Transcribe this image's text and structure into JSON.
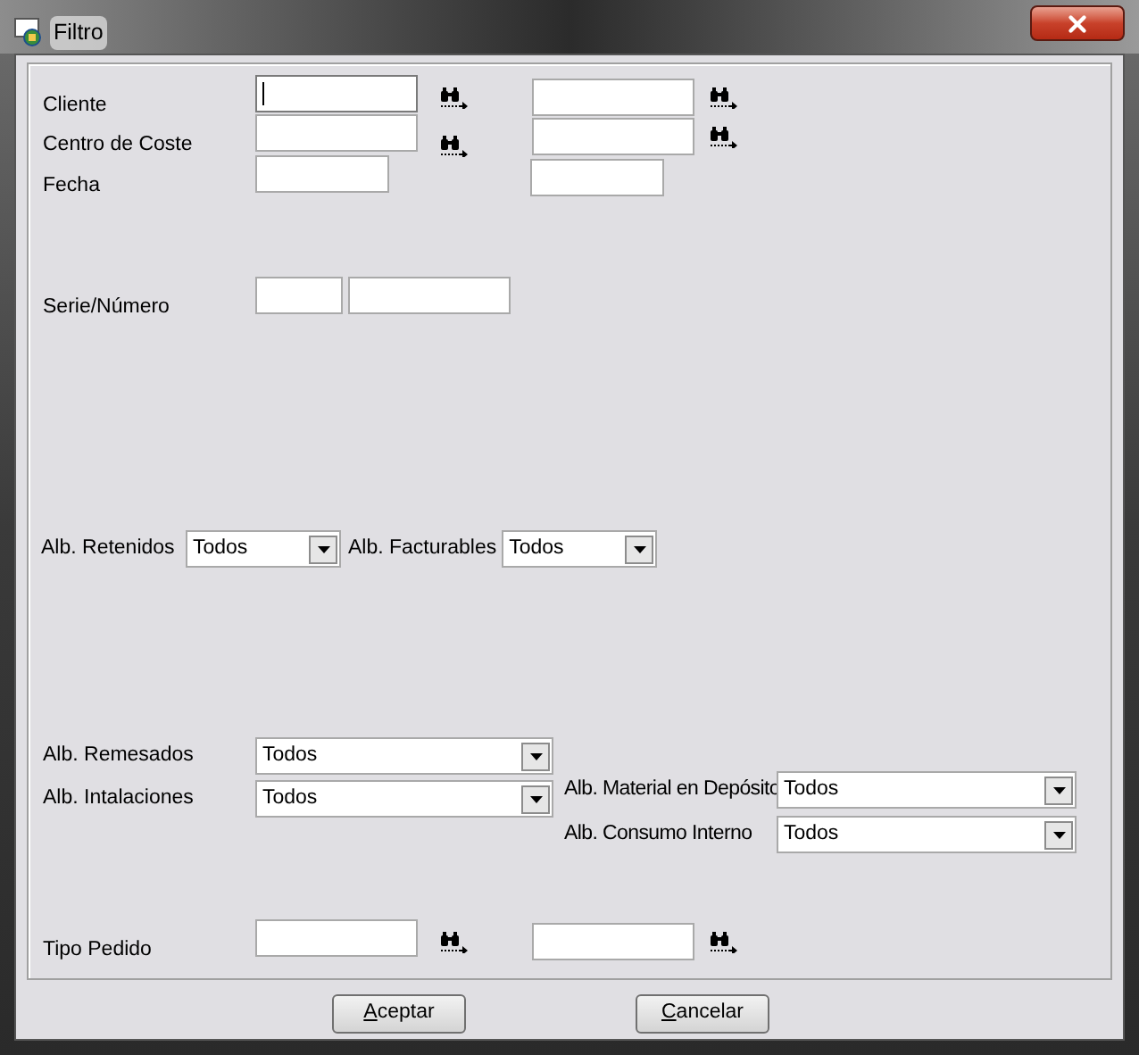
{
  "window": {
    "title": "Filtro"
  },
  "top_rows": [
    {
      "label": "Cliente",
      "fields": [
        {
          "kind": "lookup",
          "focused": true
        },
        {
          "kind": "lookup",
          "focused": false
        }
      ]
    },
    {
      "label": "Centro de Coste",
      "fields": [
        {
          "kind": "lookup",
          "focused": false
        },
        {
          "kind": "lookup",
          "focused": false
        }
      ]
    },
    {
      "label": "Fecha",
      "fields": [
        {
          "kind": "date",
          "focused": false
        },
        {
          "kind": "date",
          "focused": false
        }
      ]
    },
    {
      "label": "Serie/Número",
      "fields": [
        {
          "kind": "short",
          "focused": false
        },
        {
          "kind": "text",
          "focused": false
        }
      ]
    }
  ],
  "combos_row": [
    {
      "label": "Alb. Retenidos",
      "value": "Todos"
    },
    {
      "label": "Alb. Facturables",
      "value": "Todos"
    }
  ],
  "combos_left": [
    {
      "label": "Alb. Remesados",
      "value": "Todos"
    },
    {
      "label": "Alb. Intalaciones",
      "value": "Todos"
    }
  ],
  "combos_right": [
    {
      "label": "Alb. Material en Depósito",
      "value": "Todos"
    },
    {
      "label": "Alb. Consumo Interno",
      "value": "Todos"
    }
  ],
  "bottom_row": {
    "label": "Tipo Pedido",
    "fields": [
      {
        "kind": "lookup",
        "focused": false
      },
      {
        "kind": "lookup",
        "focused": false
      }
    ]
  },
  "buttons": [
    {
      "label": "Aceptar"
    },
    {
      "label": "Cancelar"
    }
  ]
}
